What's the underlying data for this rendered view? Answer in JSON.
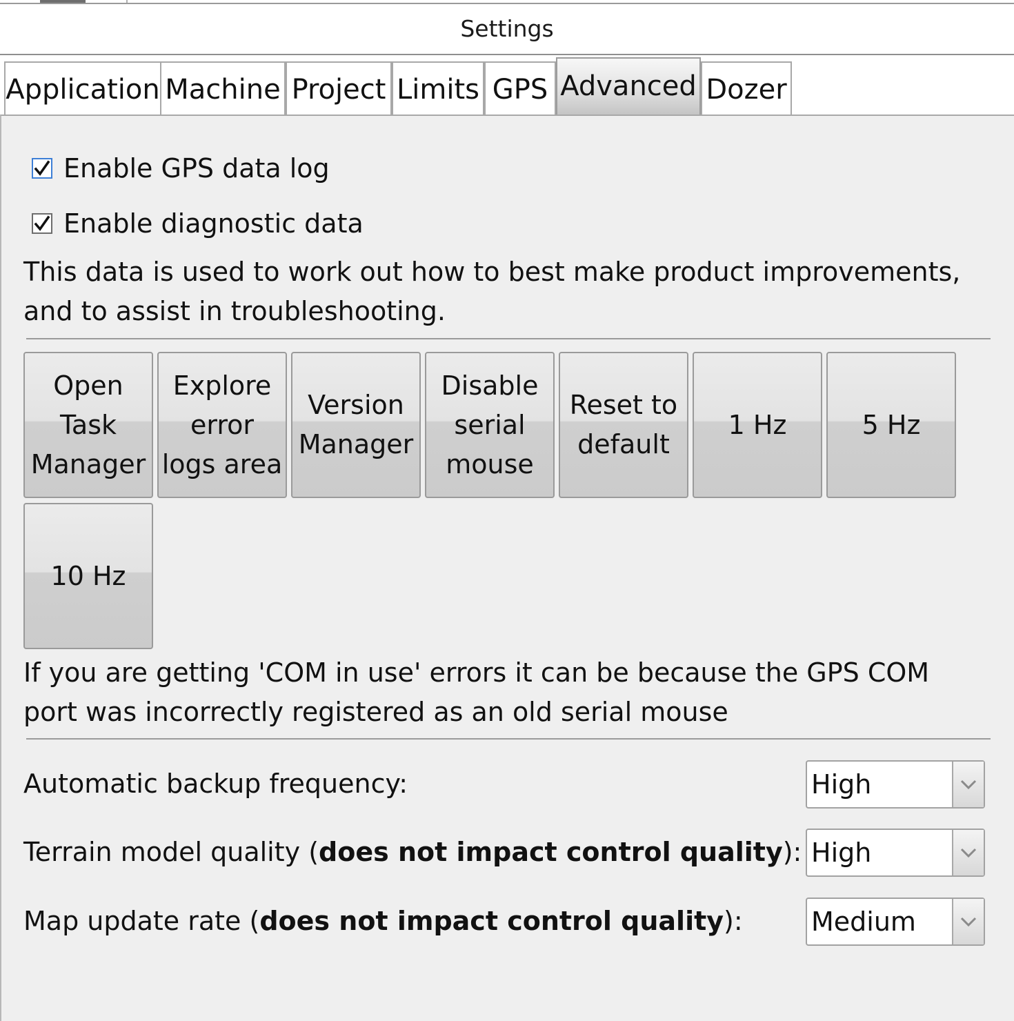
{
  "window": {
    "title": "Settings"
  },
  "tabs": [
    {
      "label": "Application"
    },
    {
      "label": "Machine"
    },
    {
      "label": "Project"
    },
    {
      "label": "Limits"
    },
    {
      "label": "GPS"
    },
    {
      "label": "Advanced",
      "active": true
    },
    {
      "label": "Dozer"
    }
  ],
  "advanced": {
    "gps_log": {
      "label": "Enable GPS data log",
      "checked": true
    },
    "diagnostic": {
      "label": "Enable diagnostic data",
      "checked": true
    },
    "diagnostic_note": "This data is used to work out how to best make product improvements, and to assist in troubleshooting.",
    "buttons": [
      {
        "label": "Open Task Manager"
      },
      {
        "label": "Explore error logs area"
      },
      {
        "label": "Version Manager"
      },
      {
        "label": "Disable serial mouse"
      },
      {
        "label": "Reset to default"
      },
      {
        "label": "1 Hz"
      },
      {
        "label": "5 Hz"
      },
      {
        "label": "10 Hz"
      }
    ],
    "com_note": "If you are getting 'COM in use' errors it can be because the GPS COM port was incorrectly registered as an old serial mouse",
    "backup": {
      "label": "Automatic backup frequency:",
      "value": "High"
    },
    "terrain": {
      "label_prefix": "Terrain model quality (",
      "label_bold": "does not impact control quality",
      "label_suffix": "):",
      "value": "High"
    },
    "map_rate": {
      "label_prefix": "Map update rate (",
      "label_bold": "does not impact control quality",
      "label_suffix": "):",
      "value": "Medium"
    }
  },
  "icons": {
    "checkmark": "checkmark-icon",
    "dropdown": "chevron-down-icon"
  }
}
